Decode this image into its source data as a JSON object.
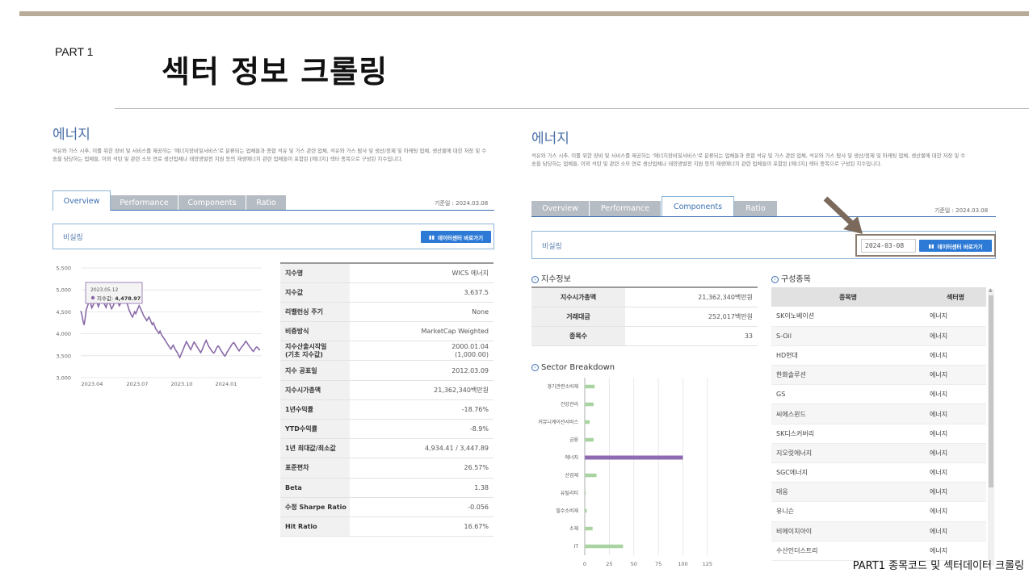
{
  "slide": {
    "part_label": "PART 1",
    "title": "섹터 정보 크롤링",
    "footer": "PART1 종목코드 및 섹터데이터 크롤링"
  },
  "left_panel": {
    "heading": "에너지",
    "description_line1": "석유와 가스 시추, 이를 위한 장비 및 서비스를 제공하는 '에너지장비및서비스'로 분류되는 업체들과 종합 석유 및 가스 관련 업체, 석유와 가스 탐사 및 생산/정제 및 마케팅 업체, 생산물에 대한 저장 및 수",
    "description_line2": "송을 담당하는 업체들, 이외 석탄 및 관련 소모 연료 생산업체나 태양광발전 지원 등의 재생에너지 관련 업체들이 포함된 [에너지] 섹터 종목으로 구성된 지수입니다.",
    "tabs": [
      "Overview",
      "Performance",
      "Components",
      "Ratio"
    ],
    "active_tab": "Overview",
    "base_date": "기준일 : 2024.03.08",
    "index_name": "비실링",
    "datacenter_button": "데이터센터 바로가기",
    "tooltip_date": "2023.05.12",
    "tooltip_label": "지수값",
    "tooltip_value": "4,478.97",
    "stats": [
      {
        "k": "지수명",
        "v": "WICS 에너지"
      },
      {
        "k": "지수값",
        "v": "3,637.5"
      },
      {
        "k": "리밸런싱 주기",
        "v": "None"
      },
      {
        "k": "비중방식",
        "v": "MarketCap Weighted"
      },
      {
        "k": "지수산출시작일\n(기초 지수값)",
        "v": "2000.01.04\n(1,000.00)"
      },
      {
        "k": "지수 공표일",
        "v": "2012.03.09"
      },
      {
        "k": "지수시가총액",
        "v": "21,362,340백만원"
      },
      {
        "k": "1년수익률",
        "v": "-18.76%"
      },
      {
        "k": "YTD수익률",
        "v": "-8.9%"
      },
      {
        "k": "1년 최대값/최소값",
        "v": "4,934.41 / 3,447.89"
      },
      {
        "k": "표준편차",
        "v": "26.57%"
      },
      {
        "k": "Beta",
        "v": "1.38"
      },
      {
        "k": "수정 Sharpe Ratio",
        "v": "-0.056"
      },
      {
        "k": "Hit Ratio",
        "v": "16.67%"
      }
    ]
  },
  "right_panel": {
    "heading": "에너지",
    "description_line1": "석유와 가스 시추, 이를 위한 장비 및 서비스를 제공하는 '에너지장비및서비스'로 분류되는 업체들과 종합 석유 및 가스 관련 업체, 석유와 가스 탐사 및 생산/정제 및 마케팅 업체, 생산물에 대한 저장 및 수",
    "description_line2": "송을 담당하는 업체들, 이외 석탄 및 관련 소모 연료 생산업체나 태양광발전 지원 등의 재생에너지 관련 업체들이 포함된 [에너지] 섹터 종목으로 구성된 지수입니다.",
    "tabs": [
      "Overview",
      "Performance",
      "Components",
      "Ratio"
    ],
    "active_tab": "Components",
    "base_date": "기준일 : 2024.03.08",
    "index_name": "비실링",
    "date_value": "2024-03-08",
    "datacenter_button": "데이터센터 바로가기",
    "index_info_title": "지수정보",
    "index_info": [
      {
        "k": "지수시가총액",
        "v": "21,362,340백만원"
      },
      {
        "k": "거래대금",
        "v": "252,017백만원"
      },
      {
        "k": "종목수",
        "v": "33"
      }
    ],
    "breakdown_title": "Sector Breakdown",
    "components_title": "구성종목",
    "components_headers": [
      "종목명",
      "섹터명"
    ],
    "components": [
      {
        "name": "SK이노베이션",
        "sector": "에너지"
      },
      {
        "name": "S-Oil",
        "sector": "에너지"
      },
      {
        "name": "HD현대",
        "sector": "에너지"
      },
      {
        "name": "한화솔루션",
        "sector": "에너지"
      },
      {
        "name": "GS",
        "sector": "에너지"
      },
      {
        "name": "씨에스윈드",
        "sector": "에너지"
      },
      {
        "name": "SK디스커버리",
        "sector": "에너지"
      },
      {
        "name": "지오릿에너지",
        "sector": "에너지"
      },
      {
        "name": "SGC에너지",
        "sector": "에너지"
      },
      {
        "name": "태웅",
        "sector": "에너지"
      },
      {
        "name": "유니슨",
        "sector": "에너지"
      },
      {
        "name": "비에이치아이",
        "sector": "에너지"
      },
      {
        "name": "수산인더스트리",
        "sector": "에너지"
      }
    ]
  },
  "colors": {
    "line": "#8a6aa8",
    "bar_highlight": "#8e6bb0",
    "bar_normal": "#a9d3a0",
    "accent_blue": "#2d7ad6",
    "arrow": "#7b6a5c"
  },
  "chart_data": [
    {
      "type": "line",
      "title": "",
      "xlabel": "",
      "ylabel": "",
      "x_ticks": [
        "2023.04",
        "2023.07",
        "2023.10",
        "2024.01"
      ],
      "y_ticks": [
        "5,500",
        "5,000",
        "4,500",
        "4,000",
        "3,500",
        "3,000"
      ],
      "ylim": [
        3000,
        5500
      ],
      "grid": true,
      "series": [
        {
          "name": "지수값",
          "values": [
            4520,
            4430,
            4300,
            4200,
            4350,
            4550,
            4620,
            4700,
            4760,
            4680,
            4590,
            4640,
            4700,
            4760,
            4810,
            4700,
            4620,
            4690,
            4740,
            4820,
            4760,
            4700,
            4650,
            4600,
            4680,
            4740,
            4700,
            4640,
            4570,
            4610,
            4670,
            4720,
            4760,
            4780,
            4700,
            4640,
            4680,
            4720,
            4760,
            4800,
            4840,
            4790,
            4700,
            4620,
            4540,
            4480,
            4420,
            4380,
            4440,
            4500,
            4460,
            4520,
            4580,
            4640,
            4600,
            4540,
            4480,
            4420,
            4380,
            4340,
            4300,
            4340,
            4380,
            4330,
            4260,
            4210,
            4250,
            4190,
            4120,
            4080,
            4050,
            4010,
            4060,
            4000,
            3950,
            3920,
            3880,
            3840,
            3800,
            3760,
            3720,
            3680,
            3650,
            3700,
            3740,
            3690,
            3640,
            3600,
            3560,
            3500,
            3460,
            3520,
            3580,
            3640,
            3700,
            3760,
            3820,
            3780,
            3730,
            3680,
            3640,
            3700,
            3760,
            3810,
            3780,
            3730,
            3690,
            3650,
            3610,
            3570,
            3620,
            3680,
            3740,
            3800,
            3850,
            3790,
            3730,
            3690,
            3650,
            3610,
            3580,
            3560,
            3600,
            3650,
            3700,
            3720,
            3690,
            3640,
            3600,
            3560,
            3520,
            3490,
            3530,
            3580,
            3620,
            3660,
            3700,
            3740,
            3780,
            3800,
            3770,
            3720,
            3680,
            3640,
            3610,
            3650,
            3690,
            3720,
            3750,
            3790,
            3830,
            3800,
            3760,
            3720,
            3690,
            3660,
            3620,
            3600,
            3640,
            3680,
            3700,
            3680,
            3640,
            3637.5
          ]
        }
      ]
    },
    {
      "type": "bar",
      "orientation": "horizontal",
      "title": "",
      "categories": [
        "경기관련소비재",
        "건강관리",
        "커뮤니케이션서비스",
        "금융",
        "에너지",
        "산업재",
        "유틸리티",
        "필수소비재",
        "소재",
        "IT"
      ],
      "values": [
        10,
        9,
        5,
        9,
        100,
        12,
        1,
        2,
        8,
        39
      ],
      "x_ticks": [
        "0",
        "25",
        "50",
        "75",
        "100",
        "125"
      ],
      "xlim": [
        0,
        135
      ],
      "grid": true,
      "highlight": "에너지"
    }
  ]
}
